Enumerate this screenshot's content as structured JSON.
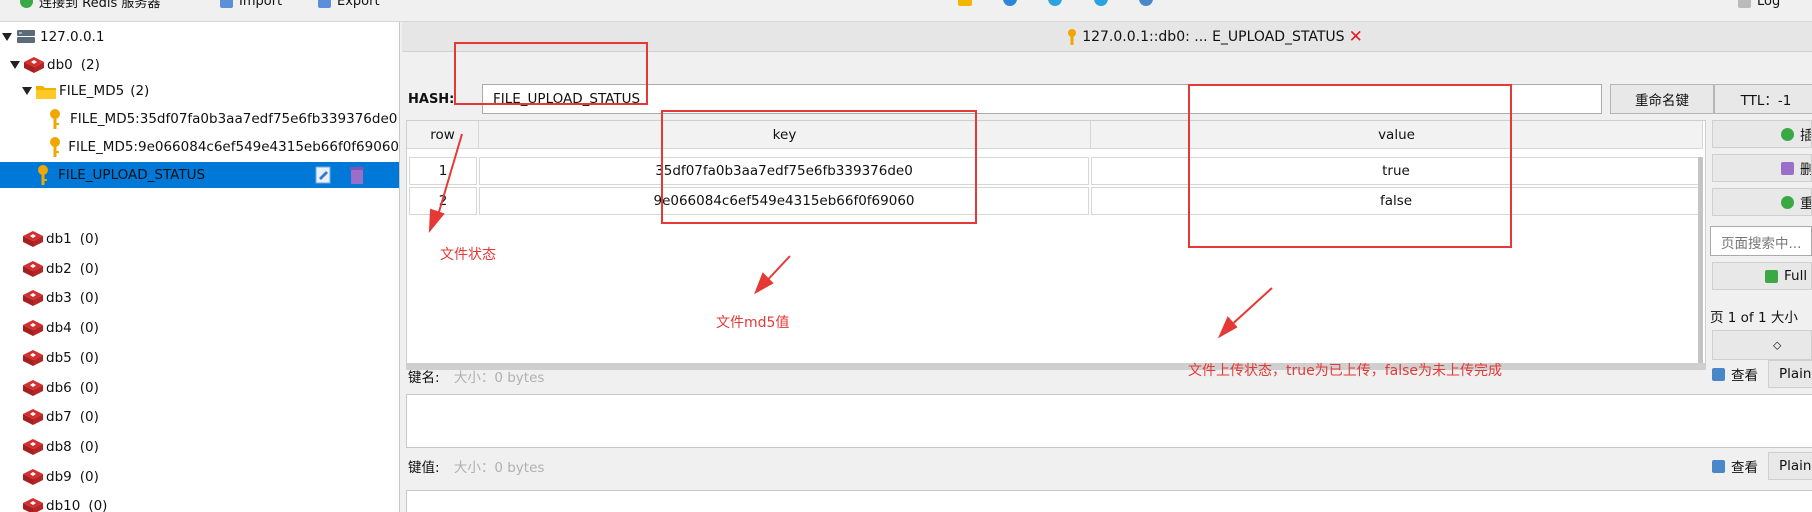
{
  "toolbar": {
    "connect_label": "连接到 Redis 服务器",
    "import_label": "Import",
    "export_label": "Export",
    "log_label": "Log"
  },
  "tree": {
    "server": "127.0.0.1",
    "db0": {
      "name": "db0",
      "count": "(2)"
    },
    "folder": {
      "name": "FILE_MD5",
      "count": "(2)"
    },
    "keys": [
      "FILE_MD5:35df07fa0b3aa7edf75e6fb339376de0",
      "FILE_MD5:9e066084c6ef549e4315eb66f0f69060"
    ],
    "selected_key": "FILE_UPLOAD_STATUS",
    "dbs": [
      {
        "name": "db1",
        "count": "(0)"
      },
      {
        "name": "db2",
        "count": "(0)"
      },
      {
        "name": "db3",
        "count": "(0)"
      },
      {
        "name": "db4",
        "count": "(0)"
      },
      {
        "name": "db5",
        "count": "(0)"
      },
      {
        "name": "db6",
        "count": "(0)"
      },
      {
        "name": "db7",
        "count": "(0)"
      },
      {
        "name": "db8",
        "count": "(0)"
      },
      {
        "name": "db9",
        "count": "(0)"
      },
      {
        "name": "db10",
        "count": "(0)"
      }
    ]
  },
  "tab": {
    "title": "127.0.0.1::db0: ... E_UPLOAD_STATUS"
  },
  "key_header": {
    "type_label": "HASH:",
    "key_name": "FILE_UPLOAD_STATUS",
    "rename_label": "重命名键",
    "ttl_label": "TTL：-1"
  },
  "table": {
    "headers": [
      "row",
      "key",
      "value"
    ],
    "rows": [
      {
        "row": "1",
        "key": "35df07fa0b3aa7edf75e6fb339376de0",
        "value": "true"
      },
      {
        "row": "2",
        "key": "9e066084c6ef549e4315eb66f0f69060",
        "value": "false"
      }
    ]
  },
  "side": {
    "insert_label": "插",
    "delete_label": "删",
    "reload_label": "重载",
    "search_placeholder": "页面搜索中...",
    "full_label": "Full",
    "pager_text": "页  1  of 1 大小",
    "pager_btn": "⬦"
  },
  "editors": {
    "key_label": "键名:",
    "key_size": "大小：0 bytes",
    "value_label": "键值:",
    "value_size": "大小：0 bytes",
    "view_label": "查看",
    "plain_label": "Plain"
  },
  "annotations": {
    "status_note": "文件状态",
    "md5_note": "文件md5值",
    "upload_note": "文件上传状态，true为已上传，false为未上传完成"
  },
  "colors": {
    "selection": "#0078d7",
    "annotation": "#e53935",
    "redis_red": "#d32f2f",
    "key_gold": "#f0a800"
  }
}
